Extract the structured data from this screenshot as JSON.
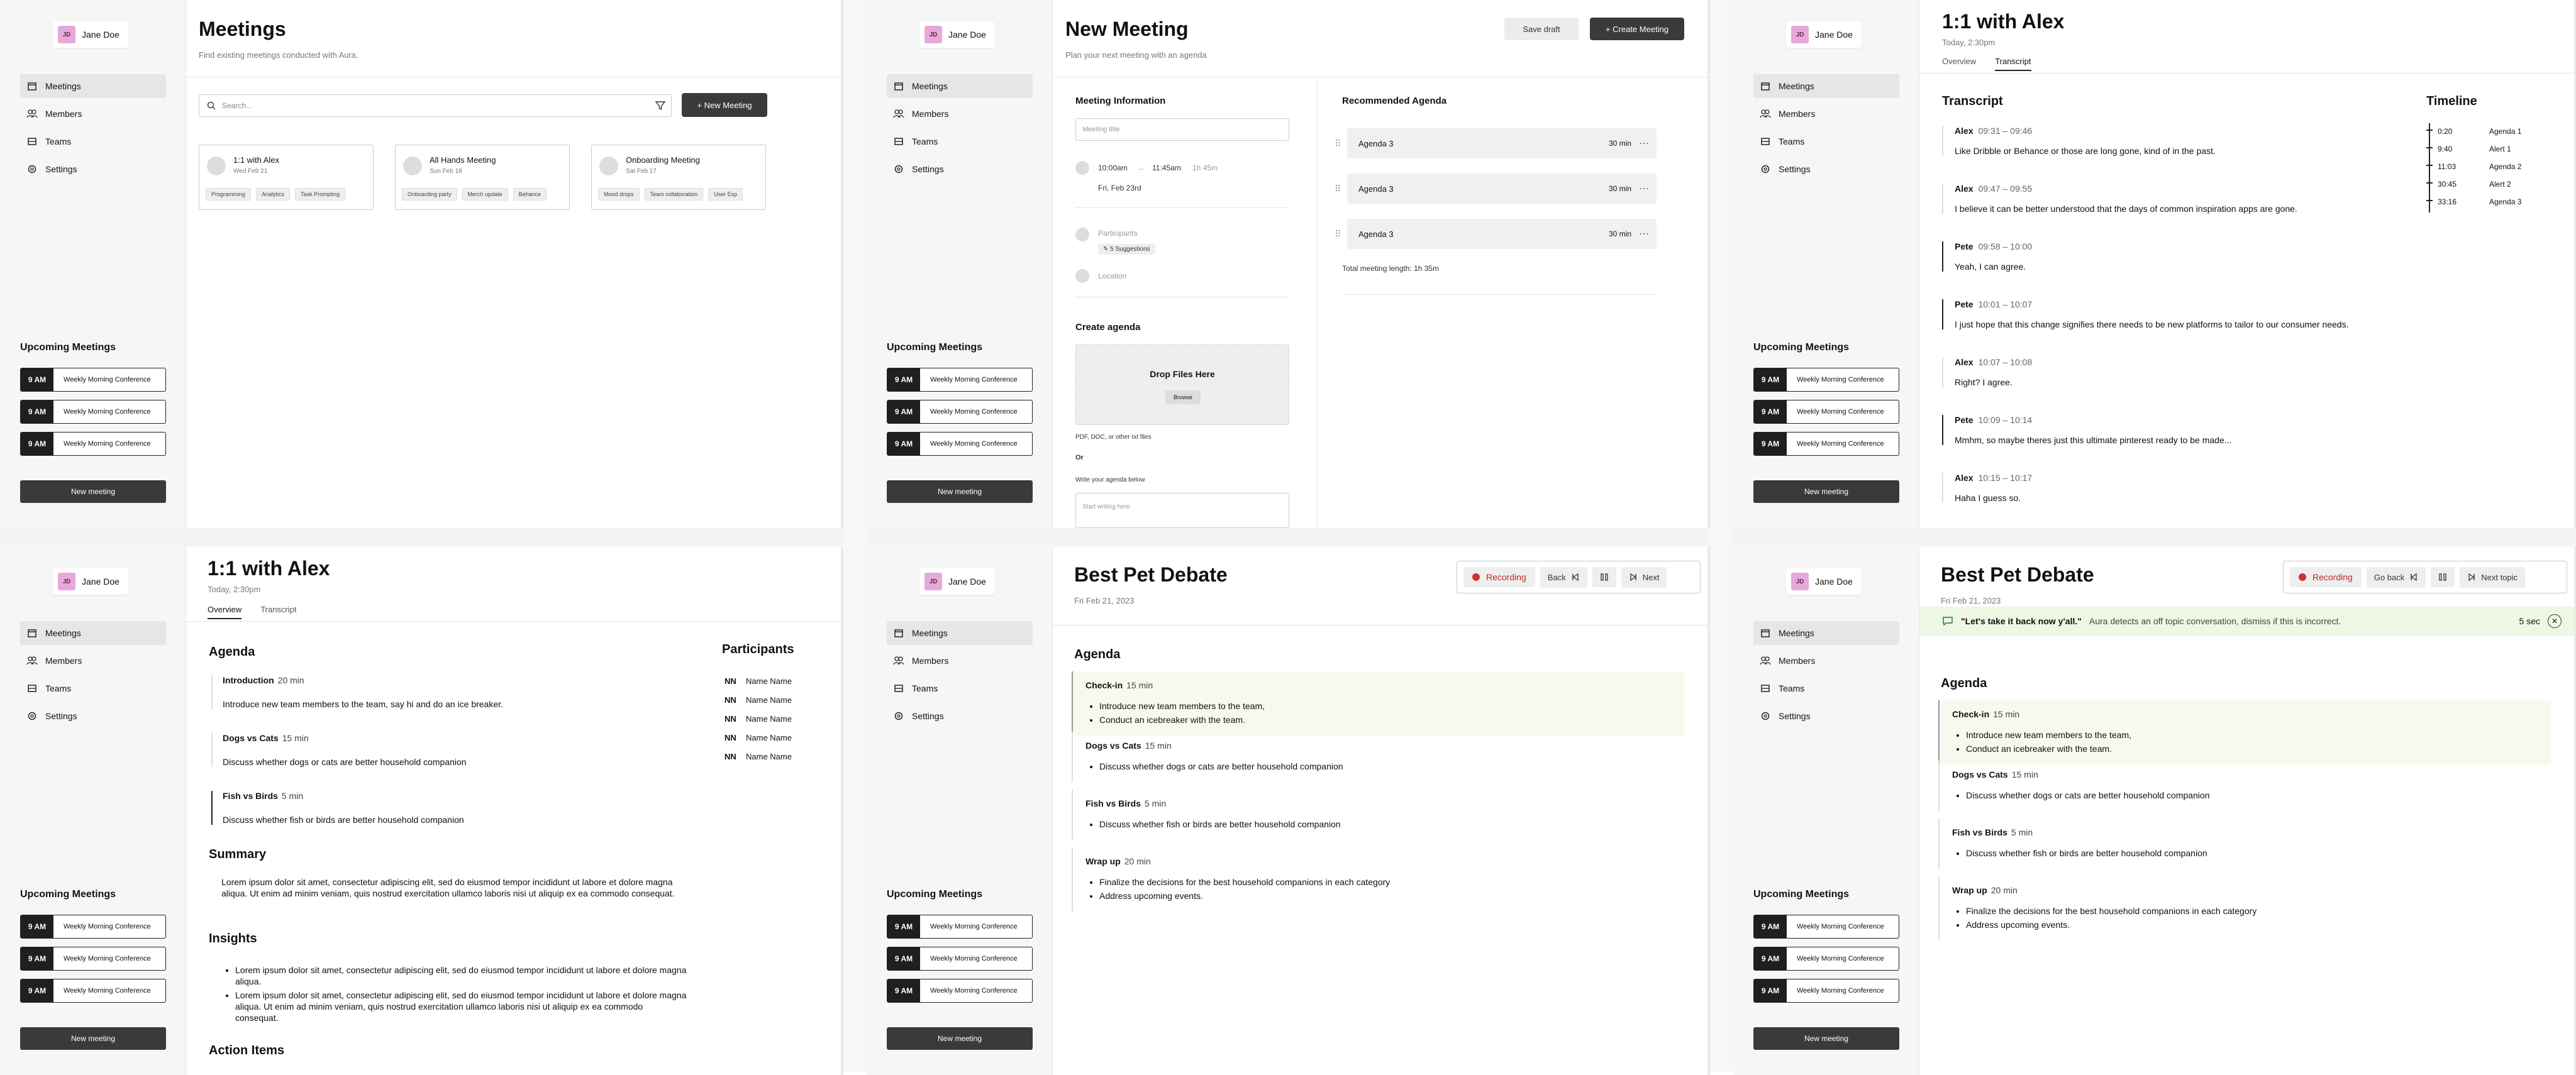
{
  "user": {
    "initials": "JD",
    "name": "Jane Doe"
  },
  "nav": [
    "Meetings",
    "Members",
    "Teams",
    "Settings"
  ],
  "upcoming": {
    "title": "Upcoming Meetings",
    "items": [
      {
        "time": "9 AM",
        "name": "Weekly Morning Conference"
      },
      {
        "time": "9 AM",
        "name": "Weekly Morning Conference"
      },
      {
        "time": "9 AM",
        "name": "Weekly Morning Conference"
      }
    ],
    "button": "New meeting"
  },
  "p1": {
    "title": "Meetings",
    "subtitle": "Find existing meetings conducted with Aura.",
    "search_placeholder": "Search...",
    "new_button": "+ New Meeting",
    "cards": [
      {
        "title": "1:1 with Alex",
        "date": "Wed Feb 21",
        "tags": [
          "Programming",
          "Analytics",
          "Task Prompting"
        ]
      },
      {
        "title": "All Hands Meeting",
        "date": "Sun Feb 18",
        "tags": [
          "Onboarding party",
          "Merch update",
          "Behance"
        ]
      },
      {
        "title": "Onboarding Meeting",
        "date": "Sat Feb 17",
        "tags": [
          "Mood drops",
          "Team collaboration",
          "User Exp"
        ]
      }
    ]
  },
  "p2": {
    "title": "New Meeting",
    "subtitle": "Plan your next meeting with an agenda",
    "save": "Save draft",
    "create": "+ Create Meeting",
    "info_title": "Meeting Information",
    "title_placeholder": "Meeting title",
    "time_from": "10:00am",
    "arrow": "→",
    "time_to": "11:45am",
    "duration": "1h 45m",
    "date": "Fri, Feb 23rd",
    "participants": "Participants",
    "suggestions": "✎ 5 Suggestions",
    "location": "Location",
    "create_agenda": "Create agenda",
    "drop": "Drop Files Here",
    "browse": "Browse",
    "filetypes": "PDF, DOC, or other txt files",
    "or": "Or",
    "write": "Write your agenda below",
    "write_placeholder": "Start writing here",
    "rec_title": "Recommended Agenda",
    "rec": [
      {
        "name": "Agenda 3",
        "dur": "30 min"
      },
      {
        "name": "Agenda 3",
        "dur": "30 min"
      },
      {
        "name": "Agenda 3",
        "dur": "30 min"
      }
    ],
    "total": "Total meeting length: 1h 35m"
  },
  "p3": {
    "title": "1:1 with Alex",
    "subtitle": "Today, 2:30pm",
    "tabs": [
      "Overview",
      "Transcript"
    ],
    "transcript_title": "Transcript",
    "lines": [
      {
        "spk": "Alex",
        "time": "09:31 – 09:46",
        "text": "Like Dribble or Behance or those are long gone, kind of in the past.",
        "dark": false
      },
      {
        "spk": "Alex",
        "time": "09:47 – 09:55",
        "text": "I believe it can be better understood that the days of common inspiration apps are gone.",
        "dark": false
      },
      {
        "spk": "Pete",
        "time": "09:58 – 10:00",
        "text": "Yeah, I can agree.",
        "dark": true
      },
      {
        "spk": "Pete",
        "time": "10:01 – 10:07",
        "text": "I just hope that this change signifies there needs to be new platforms to tailor to our consumer needs.",
        "dark": true
      },
      {
        "spk": "Alex",
        "time": "10:07 – 10:08",
        "text": "Right? I agree.",
        "dark": false
      },
      {
        "spk": "Pete",
        "time": "10:09 – 10:14",
        "text": "Mmhm, so maybe theres just this ultimate pinterest ready to be made...",
        "dark": true
      },
      {
        "spk": "Alex",
        "time": "10:15 – 10:17",
        "text": "Haha I guess so.",
        "dark": false
      }
    ],
    "timeline_title": "Timeline",
    "timeline": [
      {
        "t": "0:20",
        "l": "Agenda 1"
      },
      {
        "t": "9:40",
        "l": "Alert 1"
      },
      {
        "t": "11:03",
        "l": "Agenda 2"
      },
      {
        "t": "30:45",
        "l": "Alert 2"
      },
      {
        "t": "33:16",
        "l": "Agenda 3"
      }
    ]
  },
  "p4": {
    "title": "1:1 with Alex",
    "subtitle": "Today, 2:30pm",
    "tabs": [
      "Overview",
      "Transcript"
    ],
    "agenda_title": "Agenda",
    "agenda": [
      {
        "name": "Introduction",
        "min": "20 min",
        "desc": "Introduce new team members to the team, say hi and do an ice breaker.",
        "dark": false
      },
      {
        "name": "Dogs vs Cats",
        "min": "15 min",
        "desc": "Discuss whether dogs or cats are better household companion",
        "dark": false
      },
      {
        "name": "Fish vs Birds",
        "min": "5 min",
        "desc": "Discuss whether fish or birds are better household companion",
        "dark": true
      }
    ],
    "summary_title": "Summary",
    "summary": "Lorem ipsum dolor sit amet, consectetur adipiscing elit, sed do eiusmod tempor incididunt ut labore et dolore magna aliqua. Ut enim ad minim veniam, quis nostrud exercitation ullamco laboris nisi ut aliquip ex ea commodo consequat.",
    "insights_title": "Insights",
    "insights": [
      "Lorem ipsum dolor sit amet, consectetur adipiscing elit, sed do eiusmod tempor incididunt ut labore et dolore magna aliqua.",
      "Lorem ipsum dolor sit amet, consectetur adipiscing elit, sed do eiusmod tempor incididunt ut labore et dolore magna aliqua. Ut enim ad minim veniam, quis nostrud exercitation ullamco laboris nisi ut aliquip ex ea commodo consequat."
    ],
    "actions_title": "Action Items",
    "participants_title": "Participants",
    "participants": [
      {
        "i": "NN",
        "n": "Name Name"
      },
      {
        "i": "NN",
        "n": "Name Name"
      },
      {
        "i": "NN",
        "n": "Name Name"
      },
      {
        "i": "NN",
        "n": "Name Name"
      },
      {
        "i": "NN",
        "n": "Name Name"
      }
    ]
  },
  "p5": {
    "title": "Best Pet Debate",
    "subtitle": "Fri Feb 21, 2023",
    "recording": "Recording",
    "back": "Back",
    "next": "Next",
    "agenda_title": "Agenda",
    "items": [
      {
        "name": "Check-in",
        "min": "15 min",
        "bullets": [
          "Introduce new team members to the team,",
          "Conduct an icebreaker with the team."
        ],
        "hl": true
      },
      {
        "name": "Dogs vs Cats",
        "min": "15 min",
        "bullets": [
          "Discuss whether dogs or cats are better household companion"
        ],
        "hl": false
      },
      {
        "name": "Fish vs Birds",
        "min": "5 min",
        "bullets": [
          "Discuss whether fish or birds are better household companion"
        ],
        "hl": false
      },
      {
        "name": "Wrap up",
        "min": "20 min",
        "bullets": [
          "Finalize the decisions for the best household companions in each category",
          "Address upcoming events."
        ],
        "hl": false
      }
    ]
  },
  "p6": {
    "title": "Best Pet Debate",
    "subtitle": "Fri Feb 21, 2023",
    "recording": "Recording",
    "back": "Go back",
    "next": "Next topic",
    "alert_quote": "\"Let's take it back now y'all.\"",
    "alert_text": "Aura detects an off topic conversation, dismiss if this is incorrect.",
    "alert_timer": "5 sec",
    "agenda_title": "Agenda"
  },
  "colors": {
    "accent_dark": "#3a3a3a",
    "recording": "#d32f2f",
    "highlight": "#f6faee",
    "alert_bg": "#eef6e4",
    "avatar": "#e7a9d9"
  }
}
